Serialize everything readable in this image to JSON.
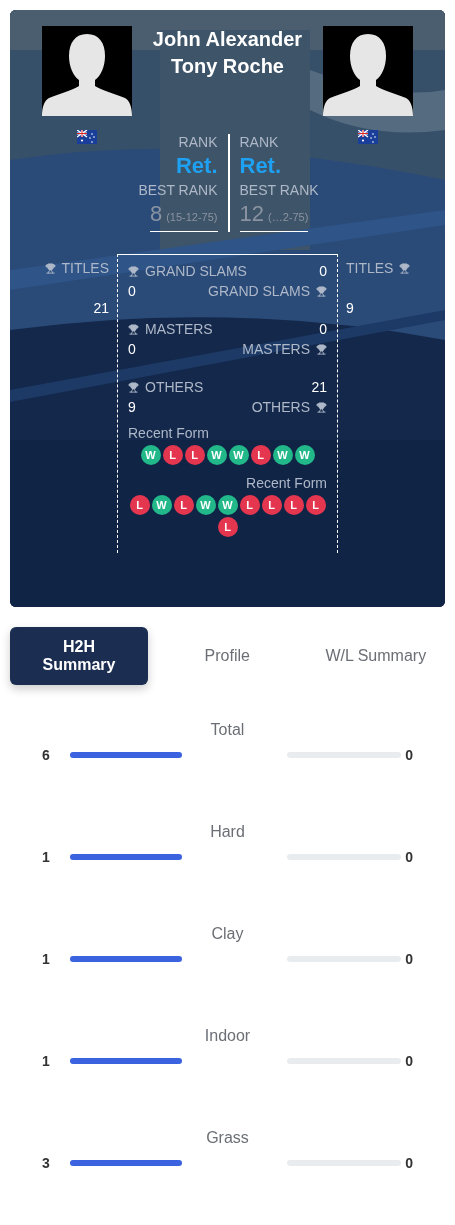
{
  "players": [
    {
      "name": "John Alexander",
      "rank_label": "RANK",
      "rank": "Ret.",
      "best_rank_label": "BEST RANK",
      "best_rank": "8",
      "best_rank_date": "(15-12-75)",
      "titles_label": "TITLES",
      "titles": "21",
      "form_label": "Recent Form",
      "form": [
        {
          "kind": "win",
          "text": "W"
        },
        {
          "kind": "loss",
          "text": "L"
        },
        {
          "kind": "loss",
          "text": "L"
        },
        {
          "kind": "win",
          "text": "W"
        },
        {
          "kind": "win",
          "text": "W"
        },
        {
          "kind": "loss",
          "text": "L"
        },
        {
          "kind": "win",
          "text": "W"
        },
        {
          "kind": "win",
          "text": "W"
        }
      ]
    },
    {
      "name": "Tony Roche",
      "rank_label": "RANK",
      "rank": "Ret.",
      "best_rank_label": "BEST RANK",
      "best_rank": "12",
      "best_rank_date": "(…2-75)",
      "titles_label": "TITLES",
      "titles": "9",
      "form_label": "Recent Form",
      "form": [
        {
          "kind": "loss",
          "text": "L"
        },
        {
          "kind": "win",
          "text": "W"
        },
        {
          "kind": "loss",
          "text": "L"
        },
        {
          "kind": "win",
          "text": "W"
        },
        {
          "kind": "win",
          "text": "W"
        },
        {
          "kind": "loss",
          "text": "L"
        },
        {
          "kind": "loss",
          "text": "L"
        },
        {
          "kind": "loss",
          "text": "L"
        },
        {
          "kind": "loss",
          "text": "L"
        },
        {
          "kind": "loss",
          "text": "L"
        }
      ]
    }
  ],
  "categories": [
    {
      "left": {
        "label": "GRAND SLAMS",
        "value": "0"
      },
      "right": {
        "label": "GRAND SLAMS",
        "value": "0"
      }
    },
    {
      "left": {
        "label": "MASTERS",
        "value": "0"
      },
      "right": {
        "label": "MASTERS",
        "value": "0"
      }
    },
    {
      "left": {
        "label": "OTHERS",
        "value": "21"
      },
      "right": {
        "label": "OTHERS",
        "value": "9"
      }
    }
  ],
  "tabs": [
    {
      "label": "H2H Summary",
      "selected": true
    },
    {
      "label": "Profile",
      "selected": false
    },
    {
      "label": "W/L Summary",
      "selected": false
    }
  ],
  "stats": [
    {
      "label": "Total",
      "left": {
        "value": "6",
        "level": 1
      },
      "right": {
        "value": "0",
        "level": 0
      }
    },
    {
      "label": "Hard",
      "left": {
        "value": "1",
        "level": 1
      },
      "right": {
        "value": "0",
        "level": 0
      }
    },
    {
      "label": "Clay",
      "left": {
        "value": "1",
        "level": 1
      },
      "right": {
        "value": "0",
        "level": 0
      }
    },
    {
      "label": "Indoor",
      "left": {
        "value": "1",
        "level": 1
      },
      "right": {
        "value": "0",
        "level": 0
      }
    },
    {
      "label": "Grass",
      "left": {
        "value": "3",
        "level": 1
      },
      "right": {
        "value": "0",
        "level": 0
      }
    }
  ]
}
